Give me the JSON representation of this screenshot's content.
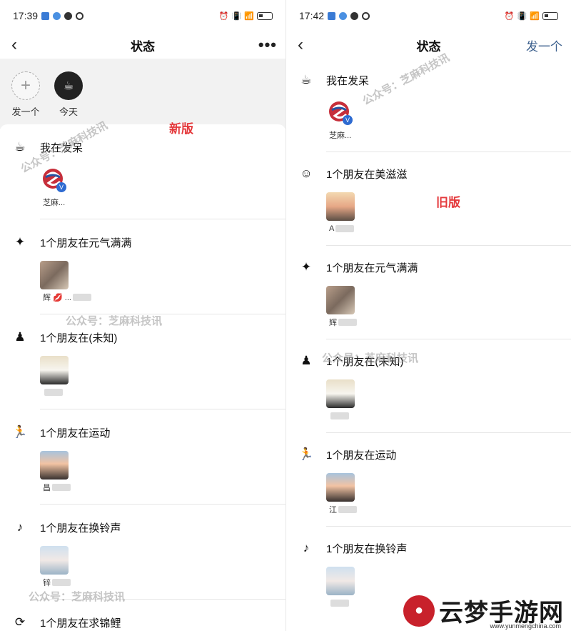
{
  "left": {
    "time": "17:39",
    "title": "状态",
    "more": "•••",
    "quick": [
      {
        "label": "发一个",
        "icon": "plus-icon",
        "glyph": "+"
      },
      {
        "label": "今天",
        "icon": "status-icon",
        "glyph": "☕"
      }
    ],
    "ribbon": "新版",
    "groups": [
      {
        "icon": "daze-icon",
        "glyph": "☕",
        "title": "我在发呆",
        "avatars": [
          {
            "style": "av-brand",
            "label": "芝麻..."
          }
        ]
      },
      {
        "icon": "energetic-icon",
        "glyph": "✦",
        "title": "1个朋友在元气满满",
        "avatars": [
          {
            "style": "av-photo1",
            "label": "辉 💋 ..."
          }
        ]
      },
      {
        "icon": "person-icon",
        "glyph": "♟",
        "title": "1个朋友在(未知)",
        "avatars": [
          {
            "style": "av-bear",
            "label": ""
          }
        ]
      },
      {
        "icon": "running-icon",
        "glyph": "🏃",
        "title": "1个朋友在运动",
        "avatars": [
          {
            "style": "av-sunset",
            "label": "昌"
          }
        ]
      },
      {
        "icon": "ringtone-icon",
        "glyph": "♪",
        "title": "1个朋友在换铃声",
        "avatars": [
          {
            "style": "av-baby",
            "label": "锌"
          }
        ]
      },
      {
        "icon": "koi-icon",
        "glyph": "⟳",
        "title": "1个朋友在求锦鲤",
        "avatars": []
      }
    ]
  },
  "right": {
    "time": "17:42",
    "title": "状态",
    "publish": "发一个",
    "ribbon": "旧版",
    "groups": [
      {
        "icon": "daze-icon",
        "glyph": "☕",
        "title": "我在发呆",
        "avatars": [
          {
            "style": "av-brand",
            "label": "芝麻..."
          }
        ]
      },
      {
        "icon": "smile-icon",
        "glyph": "☺",
        "title": "1个朋友在美滋滋",
        "avatars": [
          {
            "style": "av-photo2",
            "label": "A"
          }
        ]
      },
      {
        "icon": "energetic-icon",
        "glyph": "✦",
        "title": "1个朋友在元气满满",
        "avatars": [
          {
            "style": "av-photo1",
            "label": "辉"
          }
        ]
      },
      {
        "icon": "person-icon",
        "glyph": "♟",
        "title": "1个朋友在(未知)",
        "avatars": [
          {
            "style": "av-bear",
            "label": ""
          }
        ]
      },
      {
        "icon": "running-icon",
        "glyph": "🏃",
        "title": "1个朋友在运动",
        "avatars": [
          {
            "style": "av-sunset",
            "label": "江"
          }
        ]
      },
      {
        "icon": "ringtone-icon",
        "glyph": "♪",
        "title": "1个朋友在换铃声",
        "avatars": [
          {
            "style": "av-baby",
            "label": ""
          }
        ]
      }
    ]
  },
  "watermark": "公众号：芝麻科技讯",
  "logo": {
    "text": "云梦手游网",
    "url": "www.yunmengchina.com"
  }
}
